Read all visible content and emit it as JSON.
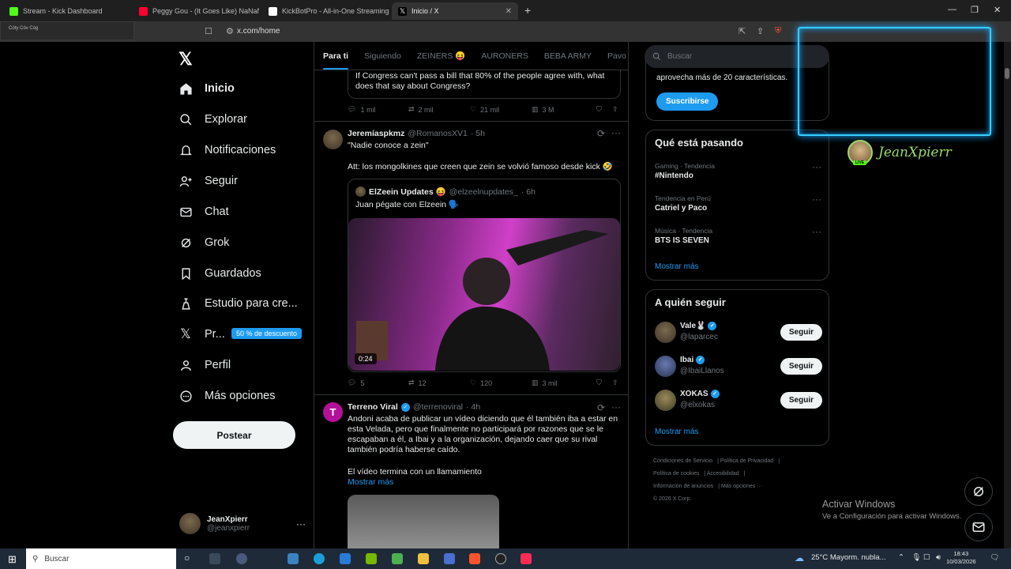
{
  "browser": {
    "tabs": [
      {
        "label": "Stream - Kick Dashboard",
        "color": "#53fc18"
      },
      {
        "label": "Peggy Gou - (It Goes Like) NaNaNa (...",
        "color": "#ff0033"
      },
      {
        "label": "KickBotPro - All-in-One Streaming To...",
        "color": "#ffffff"
      },
      {
        "label": "Inicio / X",
        "color": "#000000"
      }
    ],
    "url": "x.com/home",
    "overlay_label": "Cóty Cóv Cóg"
  },
  "nav": {
    "items": [
      {
        "label": "Inicio",
        "icon": "home-icon"
      },
      {
        "label": "Explorar",
        "icon": "search-icon"
      },
      {
        "label": "Notificaciones",
        "icon": "bell-icon"
      },
      {
        "label": "Seguir",
        "icon": "add-user-icon"
      },
      {
        "label": "Chat",
        "icon": "mail-icon"
      },
      {
        "label": "Grok",
        "icon": "grok-icon"
      },
      {
        "label": "Guardados",
        "icon": "bookmark-icon"
      },
      {
        "label": "Estudio para cre...",
        "icon": "studio-icon"
      },
      {
        "label": "Pr...",
        "icon": "x-icon"
      },
      {
        "label": "Perfil",
        "icon": "user-icon"
      },
      {
        "label": "Más opciones",
        "icon": "more-icon"
      }
    ],
    "premium_badge": "50 % de descuento",
    "post_label": "Postear",
    "account": {
      "name": "JeanXpierr",
      "handle": "@jeanxpierr"
    }
  },
  "feed": {
    "tabs": [
      "Para ti",
      "Siguiendo",
      "ZEINERS 😝",
      "AURONERS",
      "BEBA ARMY",
      "Pavo Ra"
    ],
    "post0": {
      "quote_text": "If Congress can't pass a bill that 80% of the people agree with, what does that say about Congress?",
      "replies": "1 mil",
      "reposts": "2 mil",
      "likes": "21 mil",
      "views": "3 M"
    },
    "post1": {
      "name": "Jeremíaspkmz",
      "handle": "@RomanosXV1",
      "time": "· 5h",
      "text1": "\"Nadie conoce a zein\"",
      "text2": "Att: los mongolkines que creen que zein se volvió famoso desde kick 🤣",
      "quote": {
        "name": "ElZeein Updates 😝",
        "handle": "@elzeelnupdates_",
        "time": "· 6h",
        "text": "Juan pégate con Elzeein 🗣️",
        "duration": "0:24"
      },
      "replies": "5",
      "reposts": "12",
      "likes": "120",
      "views": "3 mil"
    },
    "post2": {
      "name": "Terreno Viral",
      "handle": "@terrenoviral",
      "time": "· 4h",
      "text": "Andoni acaba de publicar un vídeo diciendo que él también iba a estar en esta Velada, pero que finalmente no participará por razones que se le escapaban a él, a Ibai y a la organización, dejando caer que su rival también podría haberse caído.",
      "text2": "El vídeo termina con un llamamiento",
      "more": "Mostrar más"
    }
  },
  "right": {
    "search_placeholder": "Buscar",
    "premium_text": "aprovecha más de 20 características.",
    "subscribe": "Suscribirse",
    "trends_title": "Qué está pasando",
    "trends": [
      {
        "category": "Gaming · Tendencia",
        "name": "#Nintendo"
      },
      {
        "category": "Tendencia en Perú",
        "name": "Catriel y Paco"
      },
      {
        "category": "Música · Tendencia",
        "name": "BTS IS SEVEN"
      }
    ],
    "show_more": "Mostrar más",
    "follow_title": "A quién seguir",
    "follow": [
      {
        "name": "Vale🐰",
        "handle": "@laparcec"
      },
      {
        "name": "Ibai",
        "handle": "@IbaiLlanos"
      },
      {
        "name": "XOKAS",
        "handle": "@elxokas"
      }
    ],
    "follow_label": "Seguir",
    "footer": [
      "Condiciones de Servicio",
      "Política de Privacidad",
      "Política de cookies",
      "Accesibilidad",
      "Información de anuncios",
      "Más opciones ···",
      "© 2026 X Corp."
    ]
  },
  "overlay": {
    "streamer": "JeanXpierr",
    "live": "LIVE"
  },
  "windows": {
    "activate_title": "Activar Windows",
    "activate_sub": "Ve a Configuración para activar Windows.",
    "search": "Buscar",
    "weather": "25°C  Mayorm. nubla...",
    "time": "18:43",
    "date": "10/03/2026"
  }
}
